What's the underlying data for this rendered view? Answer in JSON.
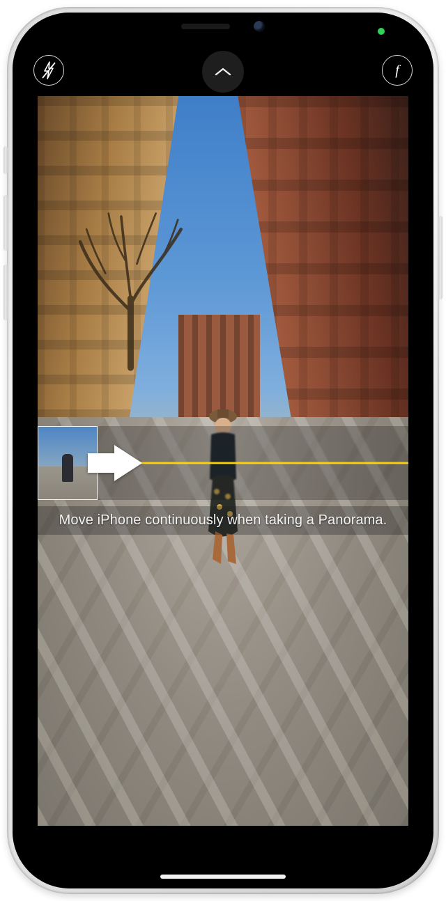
{
  "status": {
    "camera_indicator_color": "#30d158"
  },
  "camera": {
    "mode": "Panorama",
    "hint": "Move iPhone continuously when taking a Panorama.",
    "flash": "off",
    "filters_label": "f",
    "guide_line_color": "#ffd60a"
  },
  "icons": {
    "flash": "flash-off-icon",
    "chevron": "chevron-up-icon",
    "filters": "filters-icon",
    "arrow": "arrow-right-icon"
  }
}
